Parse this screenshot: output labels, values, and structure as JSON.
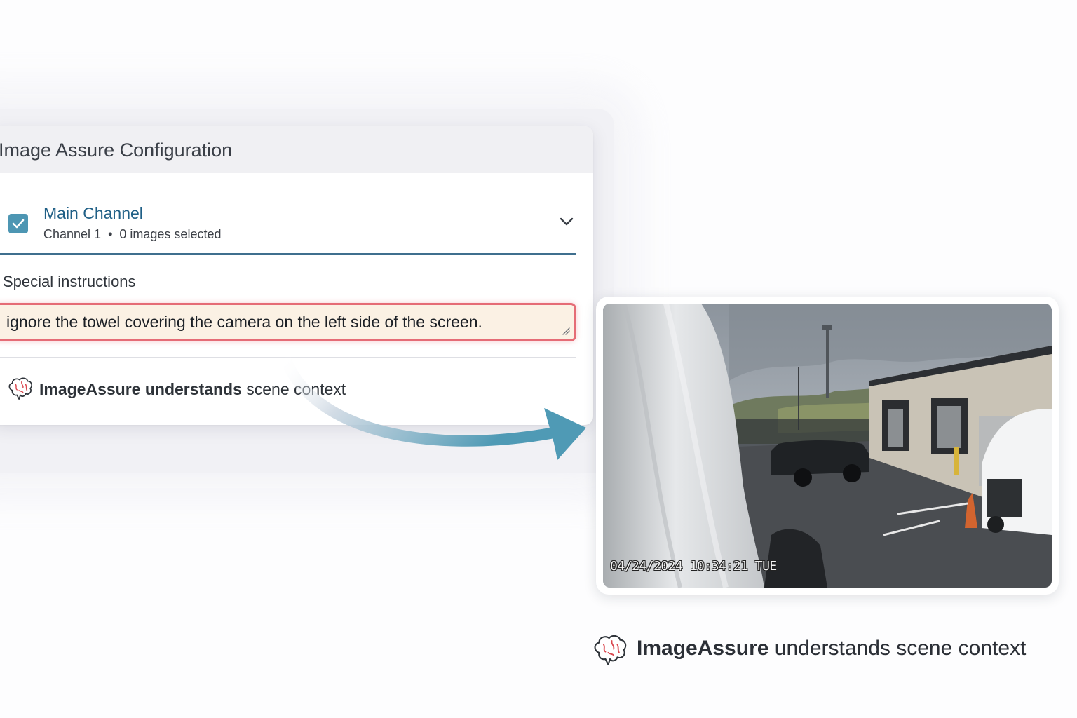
{
  "config_card": {
    "title": "Image Assure Configuration",
    "channel": {
      "checked": true,
      "name": "Main Channel",
      "sub_channel": "Channel 1",
      "separator": "•",
      "sub_images": "0 images selected"
    },
    "instructions": {
      "label": "Special instructions",
      "value": "ignore the towel covering the camera on the left side of the screen."
    },
    "footer": {
      "brand": "ImageAssure understands",
      "rest": " scene context"
    }
  },
  "camera_feed": {
    "timestamp": "04/24/2024 10:34:21 TUE"
  },
  "caption": {
    "brand": "ImageAssure",
    "rest": " understands scene context"
  },
  "colors": {
    "accent_blue": "#1f5f86",
    "checkbox": "#4d96b3",
    "error_border": "#e56c76",
    "arrow": "#5aa3bb"
  }
}
